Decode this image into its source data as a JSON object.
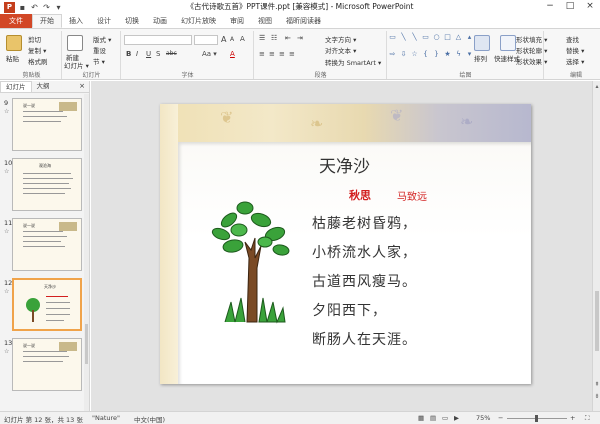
{
  "window": {
    "title": "《古代诗歌五首》PPT课件.ppt [兼容模式] - Microsoft PowerPoint",
    "app_badge": "P"
  },
  "tabs": [
    "文件",
    "开始",
    "插入",
    "设计",
    "切换",
    "动画",
    "幻灯片放映",
    "审阅",
    "视图",
    "福昕阅读器"
  ],
  "ribbon": {
    "clipboard": {
      "paste": "粘贴",
      "cut": "剪切",
      "copy": "复制 ▾",
      "format_painter": "格式刷",
      "label": "剪贴板"
    },
    "slides": {
      "new_slide": "新建",
      "new_slide2": "幻灯片 ▾",
      "layout": "版式 ▾",
      "reset": "重设",
      "section": "节 ▾",
      "label": "幻灯片"
    },
    "font": {
      "label": "字体",
      "bold": "B",
      "italic": "I",
      "underline": "U",
      "shadow": "S",
      "strike": "abc",
      "grow": "A",
      "shrink": "A",
      "clear": "A",
      "aa": "Aa ▾",
      "color": "A"
    },
    "paragraph": {
      "label": "段落",
      "text_direction": "文字方向 ▾",
      "align_text": "对齐文本 ▾",
      "smartart": "转换为 SmartArt ▾"
    },
    "drawing": {
      "label": "绘图",
      "arrange": "排列",
      "quick_styles": "快速样式",
      "shape_fill": "形状填充 ▾",
      "shape_outline": "形状轮廓 ▾",
      "shape_effects": "形状效果 ▾"
    },
    "editing": {
      "label": "编辑",
      "find": "查找",
      "replace": "替换 ▾",
      "select": "选择 ▾"
    }
  },
  "left_pane": {
    "tab_slides": "幻灯片",
    "tab_outline": "大纲",
    "close": "×",
    "thumbs": [
      {
        "num": "9",
        "mark": "☆",
        "title": "说一说"
      },
      {
        "num": "10",
        "mark": "☆",
        "title": "观沧海"
      },
      {
        "num": "11",
        "mark": "☆",
        "title": "说一说"
      },
      {
        "num": "12",
        "mark": "☆",
        "title": "天净沙"
      },
      {
        "num": "13",
        "mark": "☆",
        "title": "说一说"
      }
    ]
  },
  "slide": {
    "title": "天净沙",
    "subtitle": "秋思",
    "author": "马致远",
    "lines": [
      "枯藤老树昏鸦，",
      "小桥流水人家，",
      "古道西风瘦马。",
      "夕阳西下，",
      "断肠人在天涯。"
    ]
  },
  "status": {
    "slide_info": "幻灯片 第 12 张，共 13 张",
    "theme": "\"Nature\"",
    "language": "中文(中国)",
    "zoom": "75%",
    "zoom_minus": "−",
    "zoom_plus": "+"
  },
  "colors": {
    "file_tab": "#d24726",
    "accent_red": "#d21f1f",
    "selected_thumb": "#f0a34a"
  }
}
